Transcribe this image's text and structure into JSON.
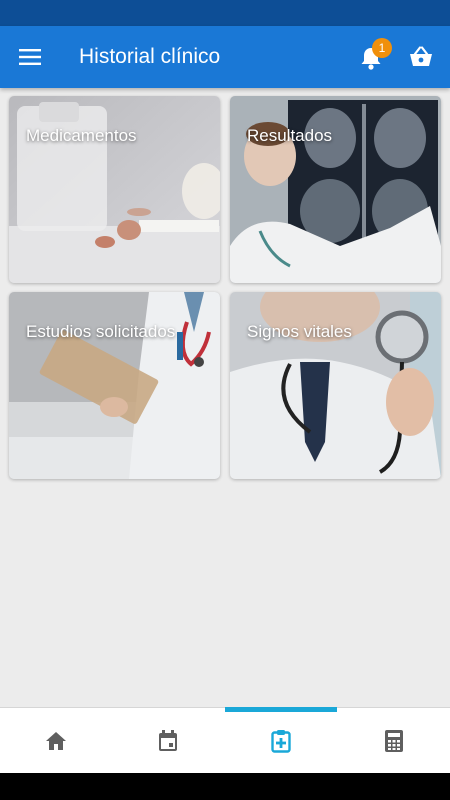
{
  "app_bar": {
    "title": "Historial clínico",
    "notification_count": "1",
    "colors": {
      "primary": "#1a78d6",
      "status_bar": "#0d4e96",
      "badge": "#f0900c"
    }
  },
  "cards": [
    {
      "label": "Medicamentos",
      "image": "pills-and-bottle"
    },
    {
      "label": "Resultados",
      "image": "doctor-xray"
    },
    {
      "label": "Estudios solicitados",
      "image": "doctor-clipboard"
    },
    {
      "label": "Signos vitales",
      "image": "doctor-stethoscope"
    }
  ],
  "bottom_nav": {
    "items": [
      {
        "icon": "home-icon",
        "active": false
      },
      {
        "icon": "calendar-icon",
        "active": false
      },
      {
        "icon": "medical-clipboard-icon",
        "active": true
      },
      {
        "icon": "calculator-icon",
        "active": false
      }
    ],
    "active_color": "#1aa8d8",
    "inactive_color": "#5f5f5f"
  }
}
